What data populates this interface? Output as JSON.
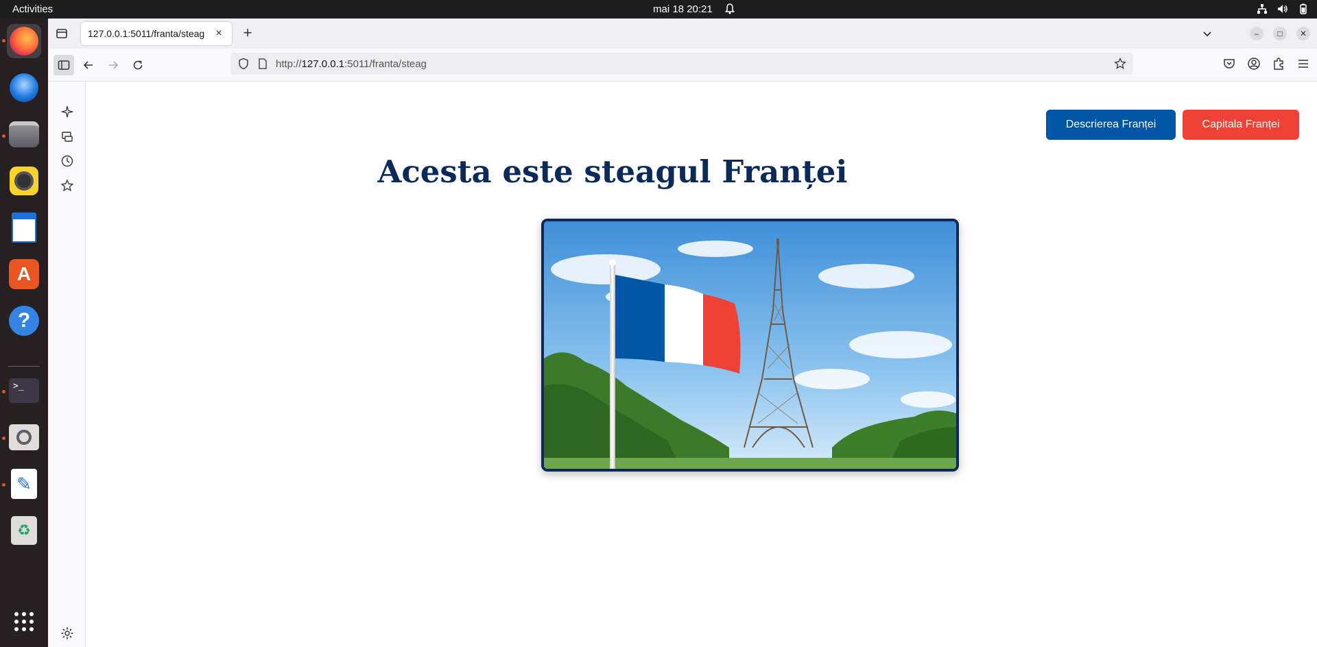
{
  "topbar": {
    "activities": "Activities",
    "clock": "mai 18  20:21"
  },
  "dock": {
    "apps": [
      "firefox-icon",
      "thunderbird-icon",
      "files-icon",
      "rhythmbox-icon",
      "writer-icon",
      "app-center-icon",
      "help-icon",
      "terminal-icon",
      "image-viewer-icon",
      "text-editor-icon",
      "trash-icon",
      "show-apps-icon"
    ]
  },
  "browser": {
    "tab_title": "127.0.0.1:5011/franta/steag",
    "tab_close": "×",
    "new_tab": "+",
    "url_prefix": "http://",
    "url_host": "127.0.0.1",
    "url_rest": ":5011/franta/steag"
  },
  "page": {
    "btn_description": "Descrierea Franței",
    "btn_capital": "Capitala Franței",
    "title": "Acesta este steagul Franței",
    "colors": {
      "blue": "#0055a4",
      "white": "#ffffff",
      "red": "#ef4135",
      "title": "#0b2a59"
    }
  }
}
